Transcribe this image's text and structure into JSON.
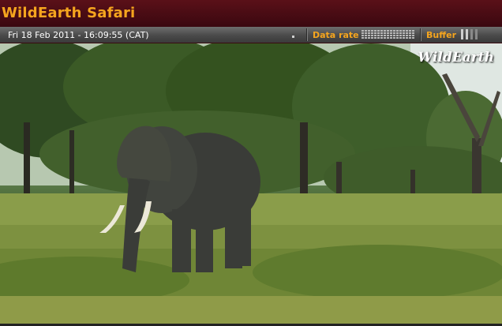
{
  "window": {
    "title": "WildEarth Safari"
  },
  "status": {
    "timestamp": "Fri 18 Feb 2011 - 16:09:55 (CAT)",
    "data_rate_label": "Data rate",
    "buffer_label": "Buffer",
    "buffer_level": 0.5,
    "accent_color": "#f5a51e"
  },
  "video": {
    "watermark": "WildEarth",
    "scene": "elephant-in-savanna"
  }
}
